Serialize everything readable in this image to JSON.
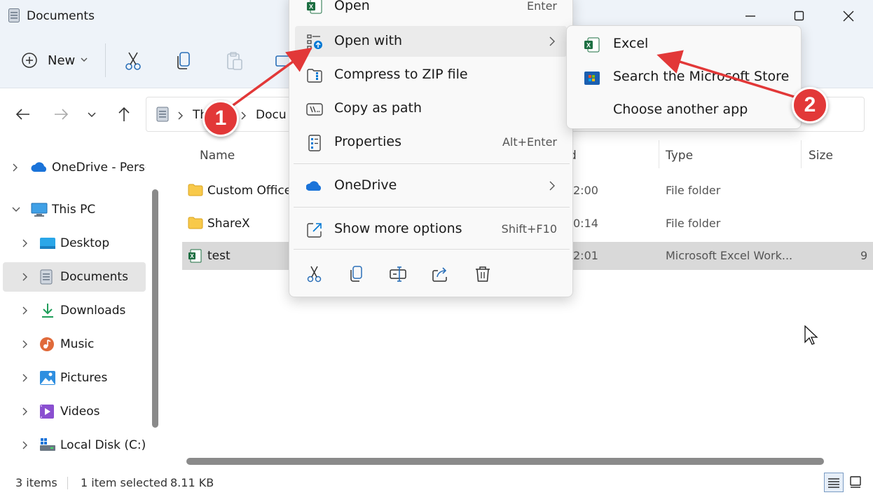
{
  "window": {
    "title": "Documents"
  },
  "toolbar": {
    "new_label": "New"
  },
  "address": {
    "crumbs": [
      "This PC",
      "Documents"
    ],
    "crumb_this_pc": "Thi",
    "crumb_documents": "Docu"
  },
  "sidebar": {
    "items": [
      {
        "label": "OneDrive - Personal",
        "icon": "onedrive-icon"
      },
      {
        "label": "This PC",
        "icon": "computer-icon"
      },
      {
        "label": "Desktop",
        "icon": "desktop-icon"
      },
      {
        "label": "Documents",
        "icon": "documents-icon"
      },
      {
        "label": "Downloads",
        "icon": "download-icon"
      },
      {
        "label": "Music",
        "icon": "music-icon"
      },
      {
        "label": "Pictures",
        "icon": "pictures-icon"
      },
      {
        "label": "Videos",
        "icon": "videos-icon"
      },
      {
        "label": "Local Disk (C:)",
        "icon": "drive-icon"
      }
    ]
  },
  "filelist": {
    "columns": {
      "name": "Name",
      "date": "d",
      "type": "Type",
      "size": "Size"
    },
    "rows": [
      {
        "name": "Custom Office",
        "date": "2:00",
        "type": "File folder",
        "size": ""
      },
      {
        "name": "ShareX",
        "date": "0:14",
        "type": "File folder",
        "size": ""
      },
      {
        "name": "test",
        "date": "2:01",
        "type": "Microsoft Excel Work...",
        "size": "9"
      }
    ]
  },
  "status": {
    "items_count": "3 items",
    "selection": "1 item selected",
    "size": "8.11 KB"
  },
  "context_menu": {
    "items": [
      {
        "label": "Open",
        "shortcut": "Enter"
      },
      {
        "label": "Open with",
        "shortcut": ""
      },
      {
        "label": "Compress to ZIP file",
        "shortcut": ""
      },
      {
        "label": "Copy as path",
        "shortcut": ""
      },
      {
        "label": "Properties",
        "shortcut": "Alt+Enter"
      },
      {
        "label": "OneDrive",
        "shortcut": ""
      },
      {
        "label": "Show more options",
        "shortcut": "Shift+F10"
      }
    ]
  },
  "submenu": {
    "items": [
      {
        "label": "Excel"
      },
      {
        "label": "Search the Microsoft Store"
      },
      {
        "label": "Choose another app"
      }
    ]
  },
  "annotations": {
    "step1": "1",
    "step2": "2",
    "color": "#e23838"
  },
  "colors": {
    "accent": "#0078d4",
    "chrome": "#eef3f9",
    "excel_green": "#1d6f42",
    "folder": "#f8c94a"
  }
}
